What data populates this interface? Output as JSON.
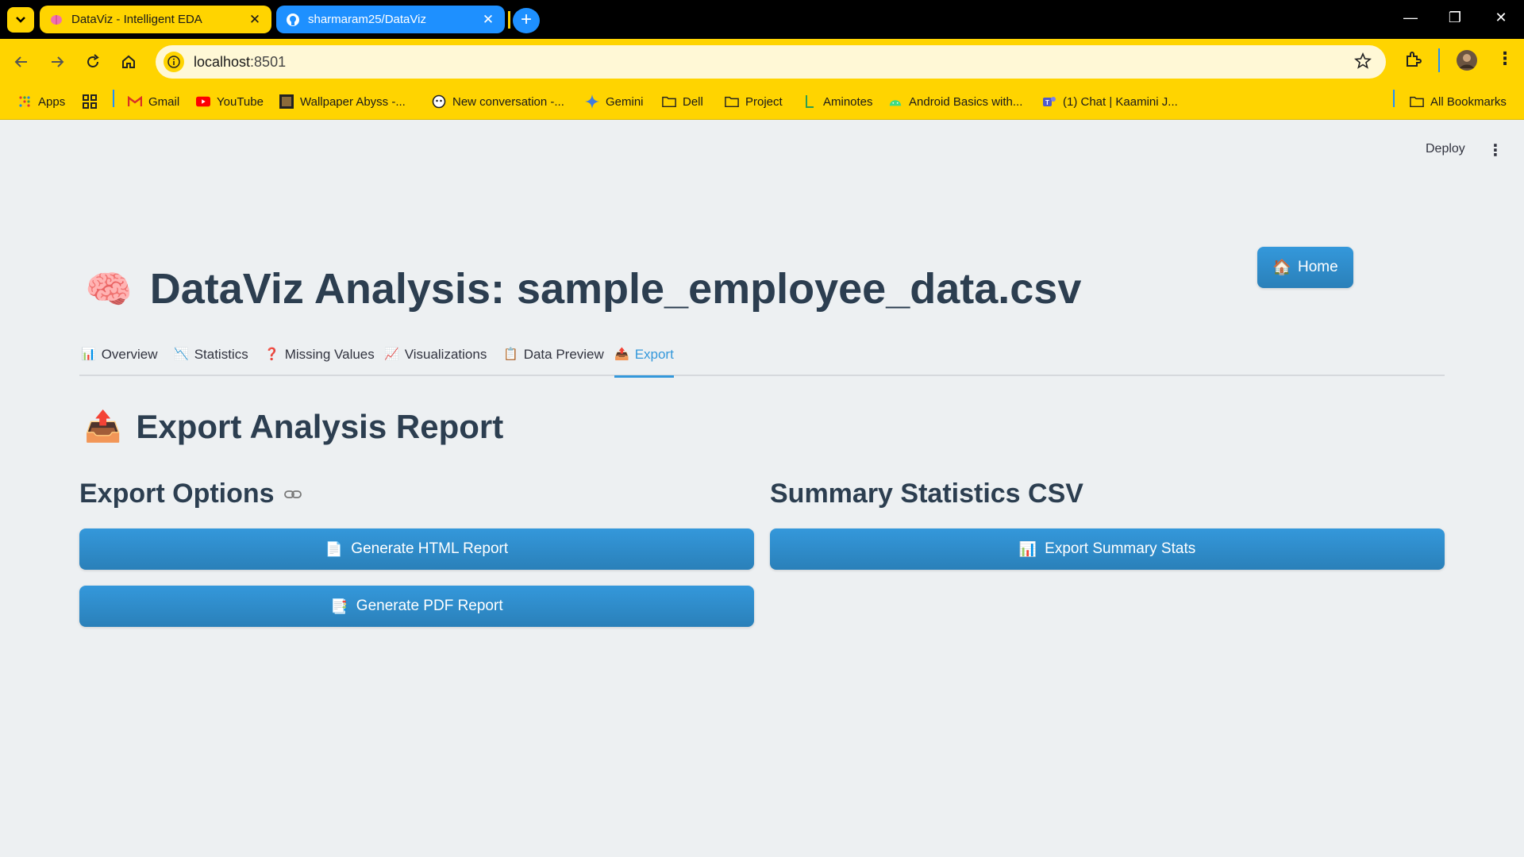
{
  "browser": {
    "tabs": [
      {
        "title": "DataViz - Intelligent EDA",
        "favicon": "brain-icon",
        "active": true
      },
      {
        "title": "sharmaram25/DataViz",
        "favicon": "github-icon",
        "active": false
      }
    ],
    "address": {
      "host": "localhost",
      "port": ":8501"
    },
    "bookmarks": [
      {
        "label": "Apps",
        "icon": "apps-grid-icon"
      },
      {
        "label": "",
        "icon": "grid-icon"
      },
      {
        "label": "Gmail",
        "icon": "gmail-icon"
      },
      {
        "label": "YouTube",
        "icon": "youtube-icon"
      },
      {
        "label": "Wallpaper Abyss -...",
        "icon": "wallpaper-icon"
      },
      {
        "label": "New conversation -...",
        "icon": "copilot-icon"
      },
      {
        "label": "Gemini",
        "icon": "gemini-icon"
      },
      {
        "label": "Dell",
        "icon": "folder-icon"
      },
      {
        "label": "Project",
        "icon": "folder-icon"
      },
      {
        "label": "Aminotes",
        "icon": "aminotes-icon"
      },
      {
        "label": "Android Basics with...",
        "icon": "android-icon"
      },
      {
        "label": "(1) Chat | Kaamini J...",
        "icon": "teams-icon"
      },
      {
        "label": "All Bookmarks",
        "icon": "folder-icon"
      }
    ]
  },
  "app": {
    "deploy_label": "Deploy",
    "home_label": "Home",
    "home_icon": "🏠",
    "title": "DataViz Analysis: sample_employee_data.csv",
    "title_icon": "🧠",
    "tabs": [
      {
        "label": "Overview",
        "icon": "📊"
      },
      {
        "label": "Statistics",
        "icon": "📉"
      },
      {
        "label": "Missing Values",
        "icon": "❓"
      },
      {
        "label": "Visualizations",
        "icon": "📈"
      },
      {
        "label": "Data Preview",
        "icon": "📋"
      },
      {
        "label": "Export",
        "icon": "📤"
      }
    ],
    "active_tab": "Export",
    "section_title": "Export Analysis Report",
    "section_icon": "📤",
    "export_options": {
      "title": "Export Options",
      "html_button": "Generate HTML Report",
      "html_icon": "📄",
      "pdf_button": "Generate PDF Report",
      "pdf_icon": "📑"
    },
    "summary_csv": {
      "title": "Summary Statistics CSV",
      "button": "Export Summary Stats",
      "icon": "📊"
    }
  }
}
